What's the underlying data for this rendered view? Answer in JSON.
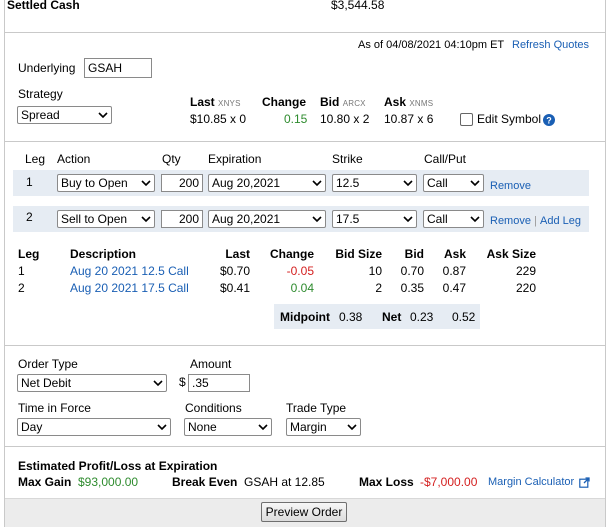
{
  "account": {
    "settled_cash_label": "Settled Cash",
    "settled_cash_value": "$3,544.58"
  },
  "quote_header": {
    "as_of": "As of 04/08/2021 04:10pm ET",
    "refresh_label": "Refresh Quotes"
  },
  "underlying": {
    "label": "Underlying",
    "value": "GSAH"
  },
  "strategy": {
    "label": "Strategy",
    "value": "Spread"
  },
  "quote": {
    "last_label": "Last",
    "last_exch": "XNYS",
    "last_value": "$10.85 x 0",
    "change_label": "Change",
    "change_value": "0.15",
    "bid_label": "Bid",
    "bid_exch": "ARCX",
    "bid_value": "10.80 x 2",
    "ask_label": "Ask",
    "ask_exch": "XNMS",
    "ask_value": "10.87 x 6",
    "edit_symbol_label": "Edit Symbol"
  },
  "legs_header": {
    "leg": "Leg",
    "action": "Action",
    "qty": "Qty",
    "expiration": "Expiration",
    "strike": "Strike",
    "callput": "Call/Put"
  },
  "legs": [
    {
      "num": "1",
      "action": "Buy to Open",
      "qty": "200",
      "expiration": "Aug 20,2021",
      "strike": "12.5",
      "callput": "Call",
      "remove": "Remove",
      "add": ""
    },
    {
      "num": "2",
      "action": "Sell to Open",
      "qty": "200",
      "expiration": "Aug 20,2021",
      "strike": "17.5",
      "callput": "Call",
      "remove": "Remove",
      "add": "Add Leg"
    }
  ],
  "quote_table": {
    "headers": {
      "leg": "Leg",
      "description": "Description",
      "last": "Last",
      "change": "Change",
      "bid_size": "Bid Size",
      "bid": "Bid",
      "ask": "Ask",
      "ask_size": "Ask Size"
    },
    "rows": [
      {
        "leg": "1",
        "description": "Aug 20 2021 12.5 Call",
        "last": "$0.70",
        "change": "-0.05",
        "bid_size": "10",
        "bid": "0.70",
        "ask": "0.87",
        "ask_size": "229"
      },
      {
        "leg": "2",
        "description": "Aug 20 2021 17.5 Call",
        "last": "$0.41",
        "change": "0.04",
        "bid_size": "2",
        "bid": "0.35",
        "ask": "0.47",
        "ask_size": "220"
      }
    ],
    "midpoint_label": "Midpoint",
    "midpoint_value": "0.38",
    "net_label": "Net",
    "net_bid": "0.23",
    "net_ask": "0.52"
  },
  "order": {
    "order_type_label": "Order Type",
    "order_type_value": "Net Debit",
    "amount_label": "Amount",
    "amount_currency": "$",
    "amount_value": ".35",
    "tif_label": "Time in Force",
    "tif_value": "Day",
    "conditions_label": "Conditions",
    "conditions_value": "None",
    "trade_type_label": "Trade Type",
    "trade_type_value": "Margin"
  },
  "estimate": {
    "title": "Estimated Profit/Loss at Expiration",
    "max_gain_label": "Max Gain",
    "max_gain_value": "$93,000.00",
    "break_even_label": "Break Even",
    "break_even_value": "GSAH at 12.85",
    "max_loss_label": "Max Loss",
    "max_loss_value": "-$7,000.00",
    "margin_calc_label": "Margin Calculator"
  },
  "footer": {
    "preview_label": "Preview Order"
  },
  "colors": {
    "link": "#1a5fb4",
    "positive": "#2e8b2e",
    "negative": "#d42020",
    "row_bg": "#e6ecf3"
  },
  "icons": [
    "chevron-down-icon",
    "help-icon",
    "external-link-icon"
  ]
}
